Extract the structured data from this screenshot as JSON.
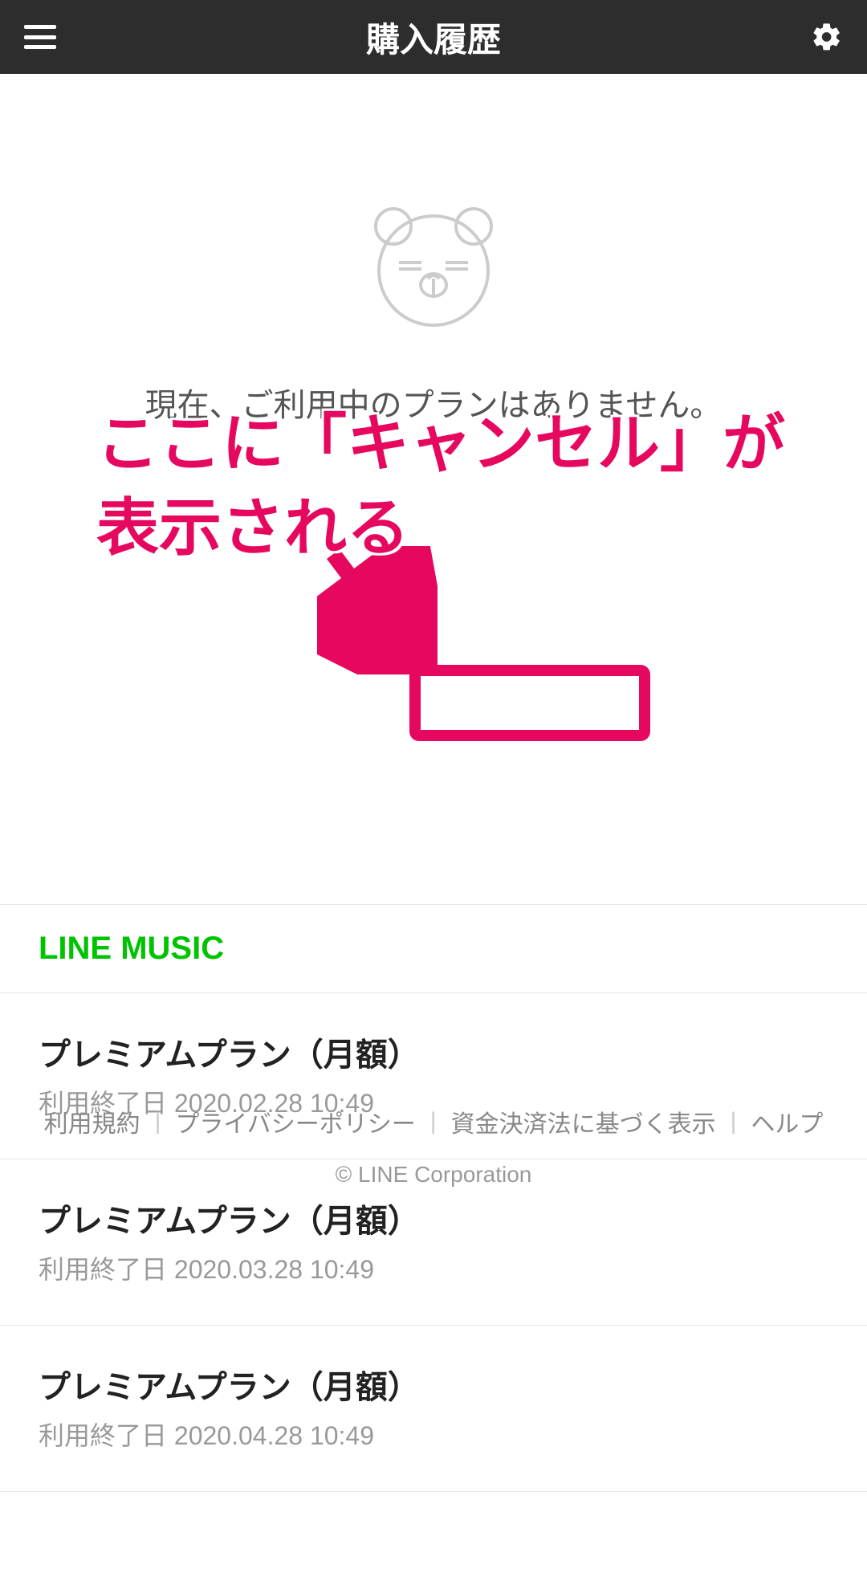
{
  "header": {
    "title": "購入履歴"
  },
  "empty": {
    "message": "現在、ご利用中のプランはありません。"
  },
  "annotation": {
    "line1": "ここに「キャンセル」が",
    "line2": "表示される"
  },
  "section": {
    "title": "LINE MUSIC"
  },
  "plans": [
    {
      "name": "プレミアムプラン（月額）",
      "date": "利用終了日 2020.02.28 10:49"
    },
    {
      "name": "プレミアムプラン（月額）",
      "date": "利用終了日 2020.03.28 10:49"
    },
    {
      "name": "プレミアムプラン（月額）",
      "date": "利用終了日 2020.04.28 10:49"
    }
  ],
  "footer": {
    "links": [
      "利用規約",
      "プライバシーポリシー",
      "資金決済法に基づく表示",
      "ヘルプ"
    ],
    "copyright": "© LINE Corporation"
  }
}
